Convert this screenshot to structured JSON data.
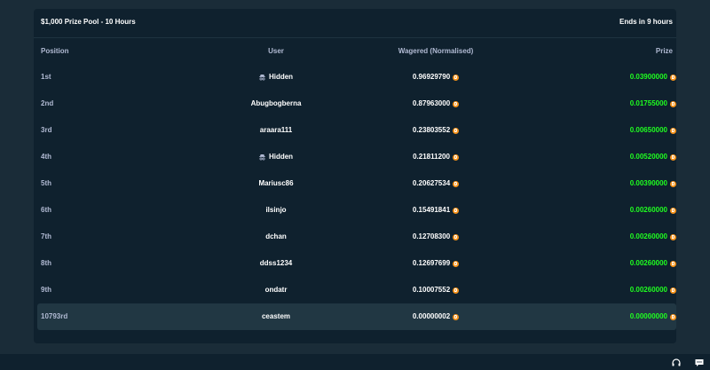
{
  "header": {
    "title": "$1,000 Prize Pool - 10 Hours",
    "ends": "Ends in 9 hours"
  },
  "columns": {
    "position": "Position",
    "user": "User",
    "wagered": "Wagered (Normalised)",
    "prize": "Prize"
  },
  "rows": [
    {
      "position": "1st",
      "user": "Hidden",
      "hidden": true,
      "wagered": "0.96929790",
      "prize": "0.03900000"
    },
    {
      "position": "2nd",
      "user": "Abugbogberna",
      "hidden": false,
      "wagered": "0.87963000",
      "prize": "0.01755000"
    },
    {
      "position": "3rd",
      "user": "araara111",
      "hidden": false,
      "wagered": "0.23803552",
      "prize": "0.00650000"
    },
    {
      "position": "4th",
      "user": "Hidden",
      "hidden": true,
      "wagered": "0.21811200",
      "prize": "0.00520000"
    },
    {
      "position": "5th",
      "user": "Mariusc86",
      "hidden": false,
      "wagered": "0.20627534",
      "prize": "0.00390000"
    },
    {
      "position": "6th",
      "user": "ilsinjo",
      "hidden": false,
      "wagered": "0.15491841",
      "prize": "0.00260000"
    },
    {
      "position": "7th",
      "user": "dchan",
      "hidden": false,
      "wagered": "0.12708300",
      "prize": "0.00260000"
    },
    {
      "position": "8th",
      "user": "ddss1234",
      "hidden": false,
      "wagered": "0.12697699",
      "prize": "0.00260000"
    },
    {
      "position": "9th",
      "user": "ondatr",
      "hidden": false,
      "wagered": "0.10007552",
      "prize": "0.00260000"
    },
    {
      "position": "10793rd",
      "user": "ceastem",
      "hidden": false,
      "wagered": "0.00000002",
      "prize": "0.00000000",
      "highlight": true
    }
  ],
  "icons": {
    "currency": "bitcoin-coin-icon",
    "hidden_user": "hidden-user-icon",
    "support": "headset-icon",
    "chat": "chat-icon"
  },
  "colors": {
    "background": "#1a2c38",
    "panel": "#0f212e",
    "highlight_row": "#213743",
    "prize_green": "#1fff20",
    "coin_orange": "#f7931a"
  }
}
